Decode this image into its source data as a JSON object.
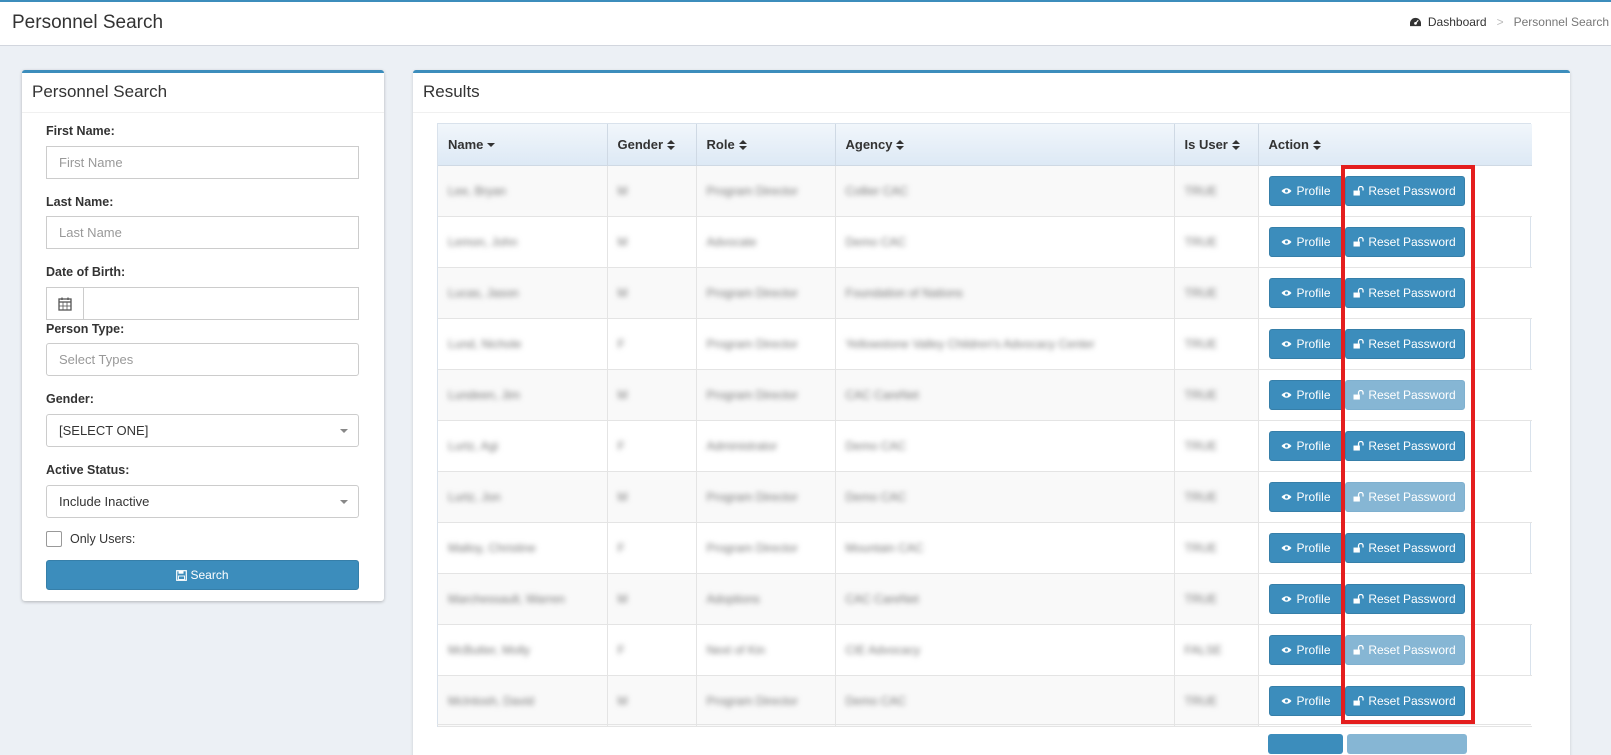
{
  "header": {
    "title": "Personnel Search",
    "breadcrumb_home": "Dashboard",
    "breadcrumb_sep": ">",
    "breadcrumb_current": "Personnel Search"
  },
  "search_panel": {
    "title": "Personnel Search",
    "first_name_label": "First Name:",
    "first_name_placeholder": "First Name",
    "last_name_label": "Last Name:",
    "last_name_placeholder": "Last Name",
    "dob_label": "Date of Birth:",
    "person_type_label": "Person Type:",
    "person_type_placeholder": "Select Types",
    "gender_label": "Gender:",
    "gender_value": "[SELECT ONE]",
    "active_status_label": "Active Status:",
    "active_status_value": "Include Inactive",
    "only_users_label": "Only Users:",
    "search_button": "Search"
  },
  "results": {
    "title": "Results",
    "columns": [
      "Name",
      "Gender",
      "Role",
      "Agency",
      "Is User",
      "Action"
    ],
    "profile_label": "Profile",
    "reset_label": "Reset Password",
    "rows": [
      {
        "name": "Lee, Bryan",
        "gender": "M",
        "role": "Program Director",
        "agency": "Collier CAC",
        "is_user": "TRUE",
        "reset_enabled": true
      },
      {
        "name": "Lemon, John",
        "gender": "M",
        "role": "Advocate",
        "agency": "Demo CAC",
        "is_user": "TRUE",
        "reset_enabled": true
      },
      {
        "name": "Lucas, Jason",
        "gender": "M",
        "role": "Program Director",
        "agency": "Foundation of Nations",
        "is_user": "TRUE",
        "reset_enabled": true
      },
      {
        "name": "Lund, Nichole",
        "gender": "F",
        "role": "Program Director",
        "agency": "Yellowstone Valley Children's Advocacy Center",
        "is_user": "TRUE",
        "reset_enabled": true
      },
      {
        "name": "Lundeen, Jim",
        "gender": "M",
        "role": "Program Director",
        "agency": "CAC CareNet",
        "is_user": "TRUE",
        "reset_enabled": false
      },
      {
        "name": "Lurtz, Agi",
        "gender": "F",
        "role": "Administrator",
        "agency": "Demo CAC",
        "is_user": "TRUE",
        "reset_enabled": true
      },
      {
        "name": "Lurtz, Jon",
        "gender": "M",
        "role": "Program Director",
        "agency": "Demo CAC",
        "is_user": "TRUE",
        "reset_enabled": false
      },
      {
        "name": "Malloy, Christine",
        "gender": "F",
        "role": "Program Director",
        "agency": "Mountain CAC",
        "is_user": "TRUE",
        "reset_enabled": true
      },
      {
        "name": "Marchessault, Warren",
        "gender": "M",
        "role": "Adoptions",
        "agency": "CAC CareNet",
        "is_user": "TRUE",
        "reset_enabled": true
      },
      {
        "name": "McButter, Molly",
        "gender": "F",
        "role": "Next of Kin",
        "agency": "CIE Advocacy",
        "is_user": "FALSE",
        "reset_enabled": false
      },
      {
        "name": "McIntosh, David",
        "gender": "M",
        "role": "Program Director",
        "agency": "Demo CAC",
        "is_user": "TRUE",
        "reset_enabled": true
      }
    ]
  },
  "colors": {
    "primary": "#3c8dbc",
    "disabled": "#86b6d4",
    "highlight": "#e41e1e"
  }
}
